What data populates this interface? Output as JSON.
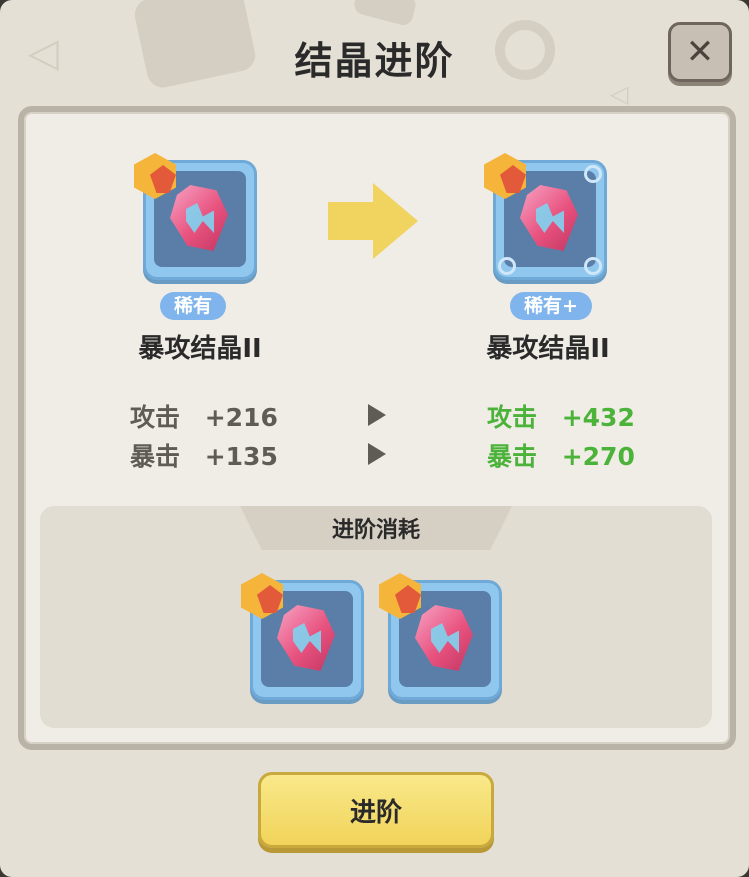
{
  "dialog": {
    "title": "结晶进阶",
    "close_label": "✕"
  },
  "upgrade": {
    "before": {
      "rarity": "稀有",
      "name": "暴攻结晶II",
      "stats": [
        {
          "label": "攻击",
          "value": "+216"
        },
        {
          "label": "暴击",
          "value": "+135"
        }
      ]
    },
    "after": {
      "rarity": "稀有+",
      "name": "暴攻结晶II",
      "stats": [
        {
          "label": "攻击",
          "value": "+432"
        },
        {
          "label": "暴击",
          "value": "+270"
        }
      ]
    }
  },
  "cost": {
    "title": "进阶消耗",
    "items": [
      {
        "icon": "crystal-icon"
      },
      {
        "icon": "crystal-icon"
      }
    ]
  },
  "advance_button": {
    "label": "进阶"
  },
  "colors": {
    "stat_new": "#4bb23a",
    "stat_old": "#5f5b55",
    "badge": "#7fb4ec",
    "button": "#f1d35a"
  }
}
